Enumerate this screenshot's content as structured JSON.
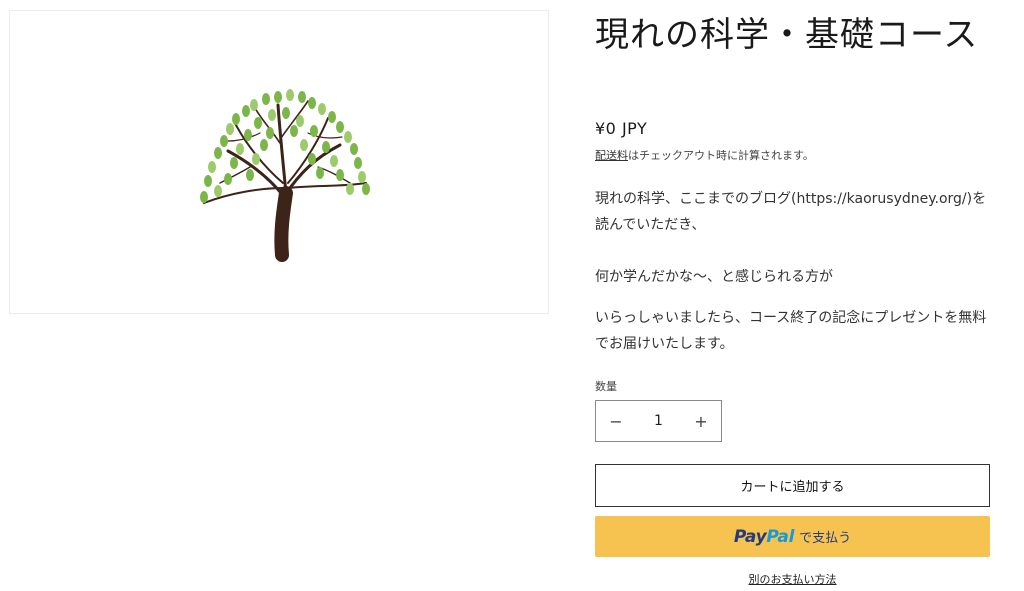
{
  "product": {
    "title": "現れの科学・基礎コース",
    "price": "¥0 JPY",
    "shipping_link": "配送料",
    "shipping_text": "はチェックアウト時に計算されます。",
    "description": [
      "現れの科学、ここまでのブログ(https://kaorusydney.org/)を読んでいただき、",
      "何か学んだかな〜、と感じられる方が",
      "いらっしゃいましたら、コース終了の記念にプレゼントを無料でお届けいたします。"
    ]
  },
  "quantity": {
    "label": "数量",
    "value": "1",
    "minus": "−",
    "plus": "+"
  },
  "buttons": {
    "add_to_cart": "カートに追加する",
    "paypal_logo_pay": "Pay",
    "paypal_logo_pal": "Pal",
    "paypal_text": "で支払う",
    "more_payment": "別のお支払い方法"
  },
  "colors": {
    "paypal_bg": "#f6c350",
    "paypal_dark": "#253b80",
    "paypal_light": "#179bd7",
    "leaf": "#7ab648",
    "trunk": "#3d2418"
  },
  "icons": {
    "product_image": "tree-illustration"
  }
}
